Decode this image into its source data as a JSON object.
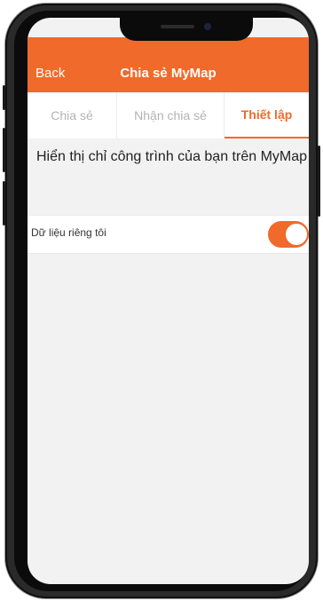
{
  "header": {
    "back_label": "Back",
    "title": "Chia sẻ MyMap"
  },
  "tabs": [
    {
      "label": "Chia sẻ",
      "active": false
    },
    {
      "label": "Nhận chia sẻ",
      "active": false
    },
    {
      "label": "Thiết lập",
      "active": true
    }
  ],
  "settings": {
    "description": "Hiển thị chỉ công trình của bạn trên MyMap",
    "rows": [
      {
        "label": "Dữ liệu riêng tôi",
        "enabled": true
      }
    ]
  },
  "colors": {
    "accent": "#f06a2b",
    "background": "#f2f2f2",
    "inactive_tab_text": "#b3b3b3"
  }
}
